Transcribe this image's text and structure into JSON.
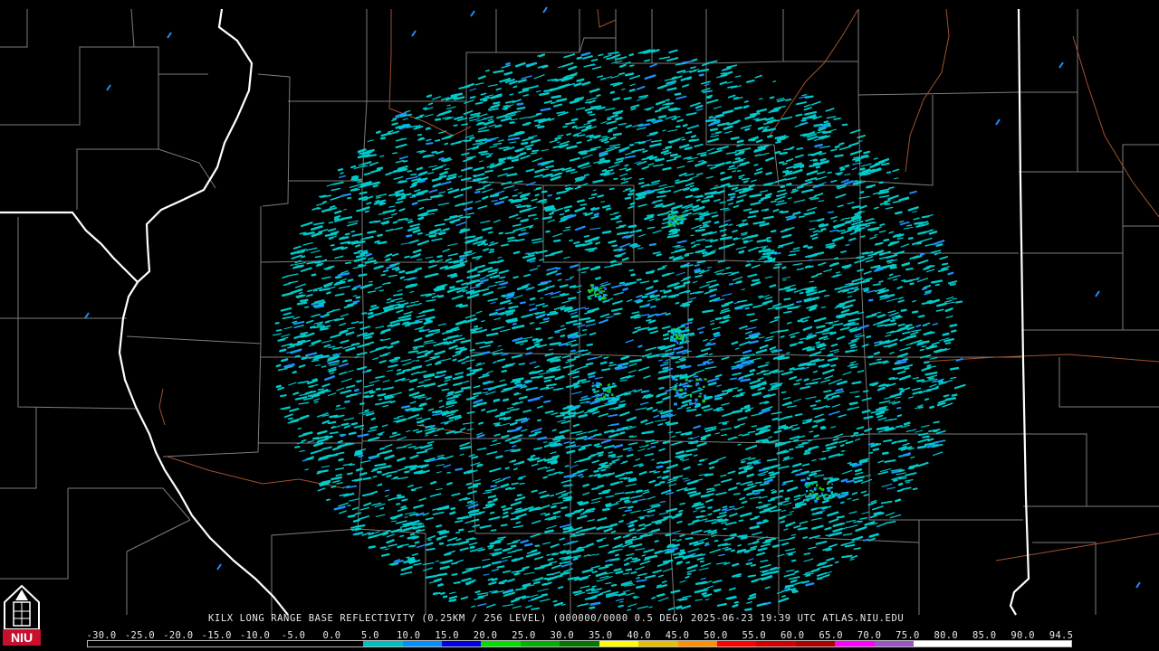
{
  "product": {
    "caption": "KILX LONG RANGE BASE REFLECTIVITY (0.25KM / 256 LEVEL) (000000/0000 0.5 DEG) 2025-06-23 19:39 UTC  ATLAS.NIU.EDU"
  },
  "logo": {
    "text": "NIU",
    "icon": "niu-tower-logo",
    "color": "#c8102e"
  },
  "legend": {
    "labels": [
      "-30.0",
      "-25.0",
      "-20.0",
      "-15.0",
      "-10.0",
      "-5.0",
      "0.0",
      "5.0",
      "10.0",
      "15.0",
      "20.0",
      "25.0",
      "30.0",
      "35.0",
      "40.0",
      "45.0",
      "50.0",
      "55.0",
      "60.0",
      "65.0",
      "70.0",
      "75.0",
      "80.0",
      "85.0",
      "90.0",
      "94.5"
    ],
    "colors": [
      "#000000",
      "#000000",
      "#000000",
      "#000000",
      "#000000",
      "#000000",
      "#000000",
      "#00bfbf",
      "#0090ff",
      "#0000e0",
      "#00e000",
      "#00b000",
      "#007a00",
      "#ffff00",
      "#e6c000",
      "#ff9000",
      "#ff0000",
      "#d40000",
      "#b00000",
      "#ff00ff",
      "#9955c8",
      "#ffffff",
      "#ffffff",
      "#ffffff",
      "#ffffff"
    ]
  },
  "colors": {
    "county_lines": "#8a8a8a",
    "state_lines": "#ffffff",
    "rivers": "#a0522d",
    "echo_light": "#00cccc",
    "echo_mid": "#1e90ff",
    "echo_green": "#22c422"
  }
}
